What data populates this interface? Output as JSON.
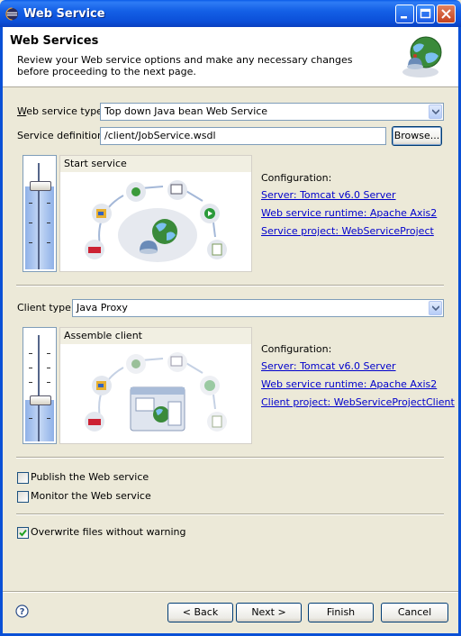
{
  "window": {
    "title": "Web Service"
  },
  "banner": {
    "title": "Web Services",
    "description": "Review your Web service options and make any necessary changes before proceeding to the next page."
  },
  "service": {
    "type_label": "Web service type:",
    "type_value": "Top down Java bean Web Service",
    "definition_label": "Service definition:",
    "definition_value": "/client/JobService.wsdl",
    "browse_label": "Browse...",
    "stage": "Start service",
    "config_heading": "Configuration:",
    "server_link": "Server: Tomcat v6.0 Server",
    "runtime_link": "Web service runtime: Apache Axis2",
    "project_link": "Service project: WebServiceProject"
  },
  "client": {
    "type_label": "Client type:",
    "type_value": "Java Proxy",
    "stage": "Assemble client",
    "config_heading": "Configuration:",
    "server_link": "Server: Tomcat v6.0 Server",
    "runtime_link": "Web service runtime: Apache Axis2",
    "project_link": "Client project: WebServiceProjectClient"
  },
  "options": {
    "publish_label": "Publish the Web service",
    "monitor_label": "Monitor the Web service",
    "overwrite_label": "Overwrite files without warning",
    "overwrite_checked": true
  },
  "footer": {
    "back_label": "< Back",
    "next_label": "Next >",
    "finish_label": "Finish",
    "cancel_label": "Cancel"
  }
}
